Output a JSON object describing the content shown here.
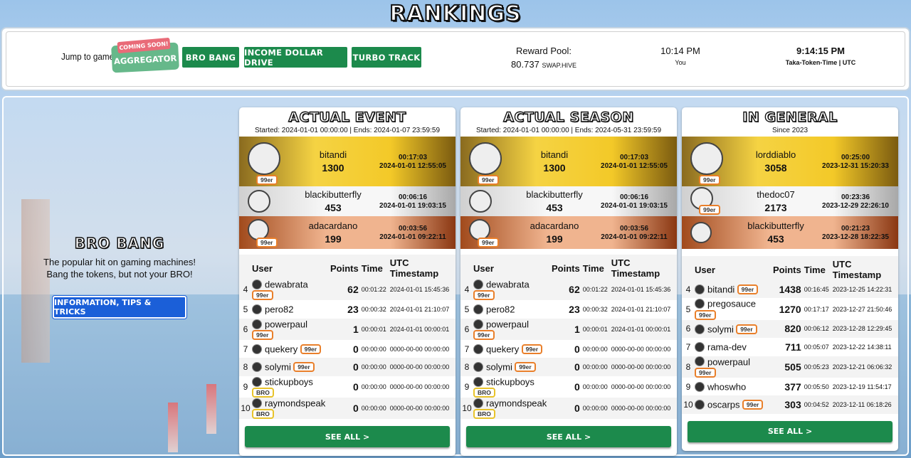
{
  "page_title": "RANKINGS",
  "topbar": {
    "jump_label": "Jump to game:",
    "coming_soon": "COMING SOON!",
    "aggregator": "AGGREGATOR",
    "games": [
      "BRO BANG",
      "INCOME DOLLAR DRIVE",
      "TURBO TRACK"
    ],
    "reward_label": "Reward Pool:",
    "reward_value": "80.737",
    "reward_unit": "SWAP.HIVE",
    "local_time": "10:14 PM",
    "local_label": "You",
    "utc_time": "9:14:15 PM",
    "utc_label": "Taka-Token-Time | UTC"
  },
  "game_info": {
    "name": "BRO BANG",
    "description": "The popular hit on gaming machines! Bang the tokens, but not your BRO!",
    "info_button": "INFORMATION, TIPS & TRICKS"
  },
  "columns": {
    "user": "User",
    "points": "Points",
    "time": "Time",
    "timestamp": "UTC Timestamp"
  },
  "see_all": "SEE ALL >",
  "boards": [
    {
      "title": "ACTUAL EVENT",
      "subtitle": "Started: 2024-01-01 00:00:00 | Ends: 2024-01-07 23:59:59",
      "podium": [
        {
          "user": "bitandi",
          "points": "1300",
          "time": "00:17:03",
          "ts": "2024-01-01 12:55:05",
          "tag": "99er"
        },
        {
          "user": "blackibutterfly",
          "points": "453",
          "time": "00:06:16",
          "ts": "2024-01-01 19:03:15",
          "tag": ""
        },
        {
          "user": "adacardano",
          "points": "199",
          "time": "00:03:56",
          "ts": "2024-01-01 09:22:11",
          "tag": "99er"
        }
      ],
      "rows": [
        {
          "rank": "4",
          "user": "dewabrata",
          "tag": "99er",
          "points": "62",
          "time": "00:01:22",
          "ts": "2024-01-01 15:45:36"
        },
        {
          "rank": "5",
          "user": "pero82",
          "tag": "",
          "points": "23",
          "time": "00:00:32",
          "ts": "2024-01-01 21:10:07"
        },
        {
          "rank": "6",
          "user": "powerpaul",
          "tag": "99er",
          "points": "1",
          "time": "00:00:01",
          "ts": "2024-01-01 00:00:01"
        },
        {
          "rank": "7",
          "user": "quekery",
          "tag": "99er",
          "points": "0",
          "time": "00:00:00",
          "ts": "0000-00-00 00:00:00"
        },
        {
          "rank": "8",
          "user": "solymi",
          "tag": "99er",
          "points": "0",
          "time": "00:00:00",
          "ts": "0000-00-00 00:00:00"
        },
        {
          "rank": "9",
          "user": "stickupboys",
          "tag": "BRO",
          "points": "0",
          "time": "00:00:00",
          "ts": "0000-00-00 00:00:00"
        },
        {
          "rank": "10",
          "user": "raymondspeak",
          "tag": "BRO",
          "points": "0",
          "time": "00:00:00",
          "ts": "0000-00-00 00:00:00"
        }
      ]
    },
    {
      "title": "ACTUAL SEASON",
      "subtitle": "Started: 2024-01-01 00:00:00 | Ends: 2024-05-31 23:59:59",
      "podium": [
        {
          "user": "bitandi",
          "points": "1300",
          "time": "00:17:03",
          "ts": "2024-01-01 12:55:05",
          "tag": "99er"
        },
        {
          "user": "blackibutterfly",
          "points": "453",
          "time": "00:06:16",
          "ts": "2024-01-01 19:03:15",
          "tag": ""
        },
        {
          "user": "adacardano",
          "points": "199",
          "time": "00:03:56",
          "ts": "2024-01-01 09:22:11",
          "tag": "99er"
        }
      ],
      "rows": [
        {
          "rank": "4",
          "user": "dewabrata",
          "tag": "99er",
          "points": "62",
          "time": "00:01:22",
          "ts": "2024-01-01 15:45:36"
        },
        {
          "rank": "5",
          "user": "pero82",
          "tag": "",
          "points": "23",
          "time": "00:00:32",
          "ts": "2024-01-01 21:10:07"
        },
        {
          "rank": "6",
          "user": "powerpaul",
          "tag": "99er",
          "points": "1",
          "time": "00:00:01",
          "ts": "2024-01-01 00:00:01"
        },
        {
          "rank": "7",
          "user": "quekery",
          "tag": "99er",
          "points": "0",
          "time": "00:00:00",
          "ts": "0000-00-00 00:00:00"
        },
        {
          "rank": "8",
          "user": "solymi",
          "tag": "99er",
          "points": "0",
          "time": "00:00:00",
          "ts": "0000-00-00 00:00:00"
        },
        {
          "rank": "9",
          "user": "stickupboys",
          "tag": "BRO",
          "points": "0",
          "time": "00:00:00",
          "ts": "0000-00-00 00:00:00"
        },
        {
          "rank": "10",
          "user": "raymondspeak",
          "tag": "BRO",
          "points": "0",
          "time": "00:00:00",
          "ts": "0000-00-00 00:00:00"
        }
      ]
    },
    {
      "title": "IN GENERAL",
      "subtitle": "Since 2023",
      "podium": [
        {
          "user": "lorddiablo",
          "points": "3058",
          "time": "00:25:00",
          "ts": "2023-12-31 15:20:33",
          "tag": "99er"
        },
        {
          "user": "thedoc07",
          "points": "2173",
          "time": "00:23:36",
          "ts": "2023-12-29 22:26:10",
          "tag": "99er"
        },
        {
          "user": "blackibutterfly",
          "points": "453",
          "time": "00:21:23",
          "ts": "2023-12-28 18:22:35",
          "tag": ""
        }
      ],
      "rows": [
        {
          "rank": "4",
          "user": "bitandi",
          "tag": "99er",
          "points": "1438",
          "time": "00:16:45",
          "ts": "2023-12-25 14:22:31"
        },
        {
          "rank": "5",
          "user": "pregosauce",
          "tag": "99er",
          "points": "1270",
          "time": "00:17:17",
          "ts": "2023-12-27 21:50:46"
        },
        {
          "rank": "6",
          "user": "solymi",
          "tag": "99er",
          "points": "820",
          "time": "00:06:12",
          "ts": "2023-12-28 12:29:45"
        },
        {
          "rank": "7",
          "user": "rama-dev",
          "tag": "",
          "points": "711",
          "time": "00:05:07",
          "ts": "2023-12-22 14:38:11"
        },
        {
          "rank": "8",
          "user": "powerpaul",
          "tag": "99er",
          "points": "505",
          "time": "00:05:23",
          "ts": "2023-12-21 06:06:32"
        },
        {
          "rank": "9",
          "user": "whoswho",
          "tag": "",
          "points": "377",
          "time": "00:05:50",
          "ts": "2023-12-19 11:54:17"
        },
        {
          "rank": "10",
          "user": "oscarps",
          "tag": "99er",
          "points": "303",
          "time": "00:04:52",
          "ts": "2023-12-11 06:18:26"
        }
      ]
    }
  ]
}
